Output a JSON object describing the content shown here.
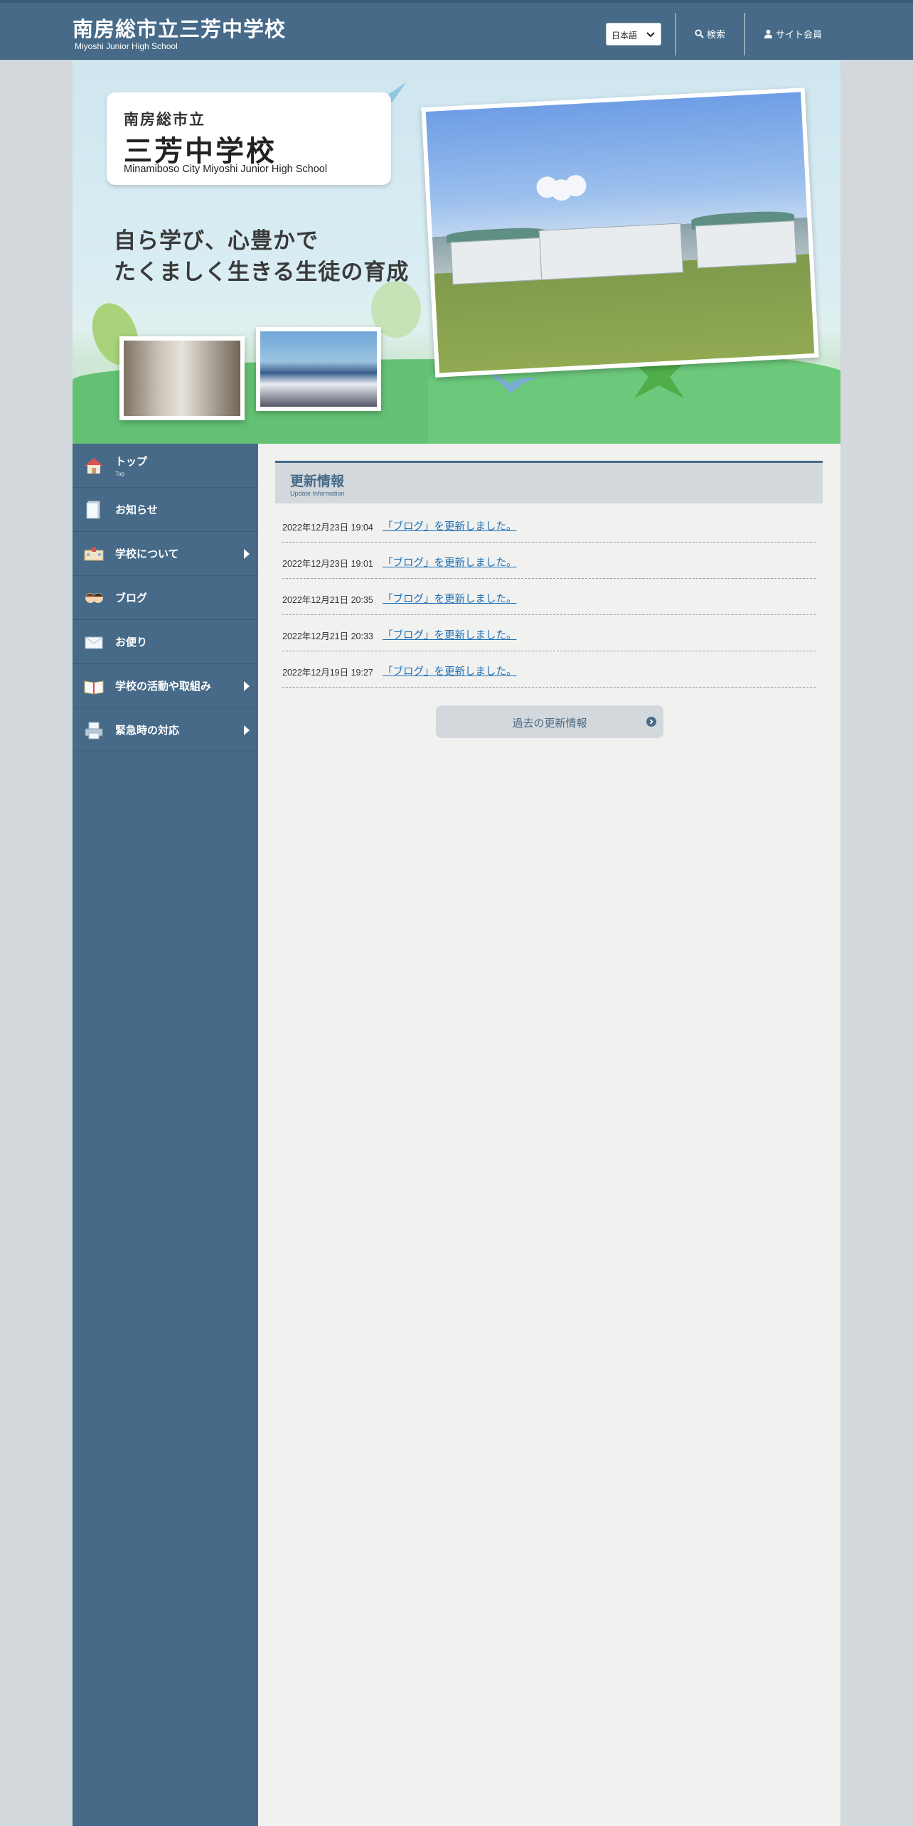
{
  "header": {
    "title": "南房総市立三芳中学校",
    "subtitle": "Miyoshi Junior High School",
    "language_selected": "日本語",
    "search_label": "検索",
    "member_label": "サイト会員"
  },
  "hero": {
    "logo_line1": "南房総市立",
    "logo_line2": "三芳中学校",
    "logo_line3": "Minamiboso City Miyoshi Junior High School",
    "motto_line1": "自ら学び、心豊かで",
    "motto_line2": "たくましく生きる生徒の育成"
  },
  "sidebar": {
    "items": [
      {
        "label": "トップ",
        "sub": "Top",
        "icon": "home-icon"
      },
      {
        "label": "お知らせ",
        "icon": "document-icon"
      },
      {
        "label": "学校について",
        "icon": "school-icon"
      },
      {
        "label": "ブログ",
        "icon": "people-icon"
      },
      {
        "label": "お便り",
        "icon": "mail-icon"
      },
      {
        "label": "学校の活動や取組み",
        "icon": "book-icon"
      },
      {
        "label": "緊急時の対応",
        "icon": "printer-icon"
      }
    ]
  },
  "updates": {
    "title": "更新情報",
    "subtitle": "Update Information",
    "items": [
      {
        "date": "2022年12月23日 19:04",
        "text": "「ブログ」を更新しました。"
      },
      {
        "date": "2022年12月23日 19:01",
        "text": "「ブログ」を更新しました。"
      },
      {
        "date": "2022年12月21日 20:35",
        "text": "「ブログ」を更新しました。"
      },
      {
        "date": "2022年12月21日 20:33",
        "text": "「ブログ」を更新しました。"
      },
      {
        "date": "2022年12月19日 19:27",
        "text": "「ブログ」を更新しました。"
      }
    ],
    "past_button": "過去の更新情報"
  },
  "colors": {
    "primary": "#466a88",
    "panel": "#d3d8dc",
    "link": "#1c6fb8",
    "content_bg": "#f1f1ef"
  }
}
